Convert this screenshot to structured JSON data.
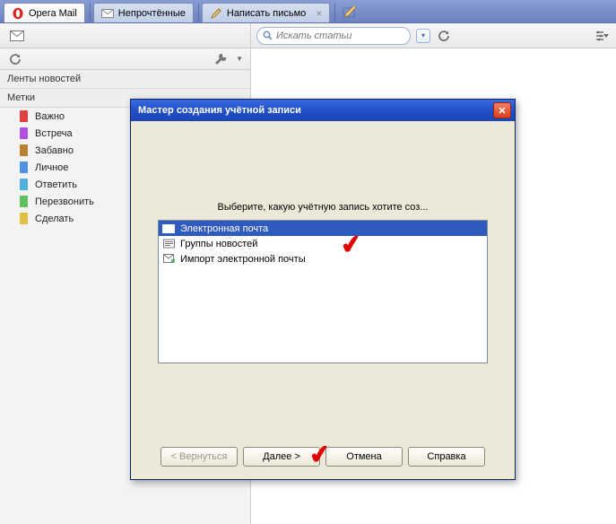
{
  "app": {
    "title": "Opera Mail"
  },
  "tabs": [
    {
      "label": "Непрочтённые",
      "icon": "mail-icon",
      "close": false
    },
    {
      "label": "Написать письмо",
      "icon": "compose-icon",
      "close": true
    }
  ],
  "search": {
    "placeholder": "Искать статьи"
  },
  "sidebar": {
    "section1": "Ленты новостей",
    "section2": "Метки",
    "labels": [
      {
        "name": "Важно",
        "color": "#e04040"
      },
      {
        "name": "Встреча",
        "color": "#b050e0"
      },
      {
        "name": "Забавно",
        "color": "#b88030"
      },
      {
        "name": "Личное",
        "color": "#5090e0"
      },
      {
        "name": "Ответить",
        "color": "#50b0e0"
      },
      {
        "name": "Перезвонить",
        "color": "#60c060"
      },
      {
        "name": "Сделать",
        "color": "#e0c040"
      }
    ]
  },
  "dialog": {
    "title": "Мастер создания учётной записи",
    "prompt": "Выберите, какую учётную запись хотите соз...",
    "options": [
      {
        "label": "Электронная почта",
        "selected": true
      },
      {
        "label": "Группы новостей",
        "selected": false
      },
      {
        "label": "Импорт электронной почты",
        "selected": false
      }
    ],
    "buttons": {
      "back": "< Вернуться",
      "next": "Далее >",
      "cancel": "Отмена",
      "help": "Справка"
    }
  }
}
